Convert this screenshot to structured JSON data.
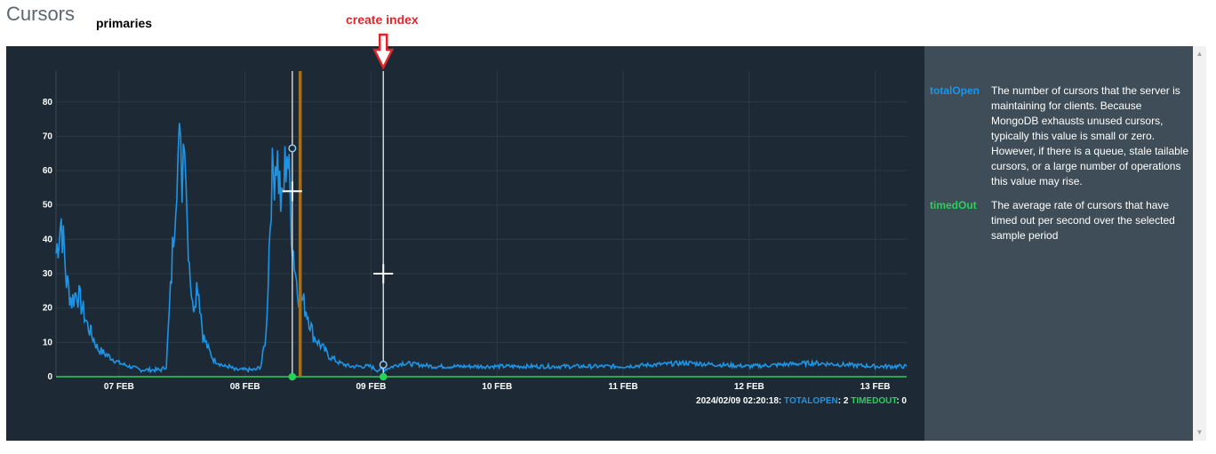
{
  "header": {
    "title": "Cursors",
    "subtitle": "primaries",
    "annotation": "create index"
  },
  "colors": {
    "panel_bg": "#1d2a35",
    "legend_bg": "#3e4d57",
    "totalOpen": "#1c95e8",
    "timedOut": "#28d15a",
    "annotation": "#e0262a",
    "marker_line": "#a36e1f"
  },
  "chart_data": {
    "type": "line",
    "x_tick_labels": [
      "07 FEB",
      "08 FEB",
      "09 FEB",
      "10 FEB",
      "11 FEB",
      "12 FEB",
      "13 FEB"
    ],
    "y_ticks": [
      0,
      10,
      20,
      30,
      40,
      50,
      60,
      70,
      80
    ],
    "ylim": [
      0,
      89
    ],
    "grid": true,
    "series": [
      {
        "name": "totalOpen",
        "color": "#1c95e8",
        "x": [
          "06 Feb 12:00",
          "06 Feb 13:00",
          "06 Feb 14:00",
          "06 Feb 15:00",
          "06 Feb 16:00",
          "06 Feb 18:00",
          "06 Feb 20:00",
          "06 Feb 22:00",
          "07 Feb 00:00",
          "07 Feb 02:00",
          "07 Feb 04:00",
          "07 Feb 06:00",
          "07 Feb 08:00",
          "07 Feb 09:00",
          "07 Feb 10:00",
          "07 Feb 11:00",
          "07 Feb 11:30",
          "07 Feb 12:00",
          "07 Feb 12:30",
          "07 Feb 13:00",
          "07 Feb 14:00",
          "07 Feb 15:00",
          "07 Feb 16:00",
          "07 Feb 17:00",
          "07 Feb 18:00",
          "07 Feb 19:00",
          "07 Feb 20:00",
          "07 Feb 21:00",
          "07 Feb 22:00",
          "07 Feb 23:00",
          "08 Feb 00:00",
          "08 Feb 01:00",
          "08 Feb 02:00",
          "08 Feb 03:00",
          "08 Feb 04:00",
          "08 Feb 05:00",
          "08 Feb 06:00",
          "08 Feb 07:00",
          "08 Feb 08:00",
          "08 Feb 09:00",
          "08 Feb 10:00",
          "08 Feb 11:00",
          "08 Feb 12:00",
          "08 Feb 13:00",
          "08 Feb 14:00",
          "08 Feb 15:00",
          "08 Feb 16:00",
          "08 Feb 18:00",
          "08 Feb 20:00",
          "08 Feb 22:00",
          "09 Feb 00:00",
          "09 Feb 01:00",
          "09 Feb 02:20",
          "09 Feb 06:00",
          "09 Feb 12:00",
          "10 Feb 00:00",
          "10 Feb 12:00",
          "11 Feb 00:00",
          "11 Feb 12:00",
          "12 Feb 00:00",
          "12 Feb 12:00",
          "13 Feb 00:00",
          "13 Feb 06:00"
        ],
        "values": [
          36,
          46,
          28,
          22,
          25,
          15,
          8,
          6,
          4,
          3,
          2,
          2,
          2,
          3,
          30,
          62,
          66,
          58,
          78,
          45,
          20,
          28,
          12,
          8,
          5,
          4,
          3,
          3,
          2,
          2,
          2,
          2,
          2,
          3,
          12,
          55,
          66,
          48,
          68,
          40,
          25,
          22,
          18,
          12,
          10,
          8,
          6,
          4,
          3,
          3,
          3,
          2,
          2,
          4,
          3,
          3,
          3,
          3,
          4,
          3,
          4,
          3,
          3
        ]
      },
      {
        "name": "timedOut",
        "color": "#28d15a",
        "x": [
          "06 Feb 12:00",
          "13 Feb 06:00"
        ],
        "values": [
          0,
          0
        ]
      }
    ]
  },
  "status": {
    "timestamp": "2024/02/09 02:20:18:",
    "key1": "TOTALOPEN",
    "val1": ": 2",
    "key2": "TIMEDOUT",
    "val2": ": 0"
  },
  "legend": [
    {
      "key": "totalOpen",
      "color": "#1c95e8",
      "description": "The number of cursors that the server is maintaining for clients. Because MongoDB exhausts unused cursors, typically this value is small or zero. However, if there is a queue, stale tailable cursors, or a large number of operations this value may rise."
    },
    {
      "key": "timedOut",
      "color": "#28d15a",
      "description": "The average rate of cursors that have timed out per second over the selected sample period"
    }
  ]
}
